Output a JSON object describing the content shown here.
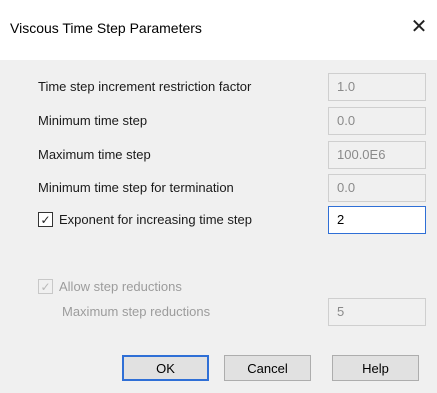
{
  "window": {
    "title": "Viscous Time Step Parameters",
    "close_glyph": "✕"
  },
  "fields": [
    {
      "label": "Time step increment restriction factor",
      "value": "1.0"
    },
    {
      "label": "Minimum time step",
      "value": "0.0"
    },
    {
      "label": "Maximum time step",
      "value": "100.0E6"
    },
    {
      "label": "Minimum time step for termination",
      "value": "0.0"
    }
  ],
  "exponent": {
    "label": "Exponent for increasing time step",
    "checked": true,
    "value": "2"
  },
  "reductions": {
    "allow_label": "Allow step reductions",
    "allow_checked": true,
    "max_label": "Maximum step reductions",
    "max_value": "5"
  },
  "buttons": {
    "ok": "OK",
    "cancel": "Cancel",
    "help": "Help"
  },
  "icons": {
    "check": "✓"
  }
}
